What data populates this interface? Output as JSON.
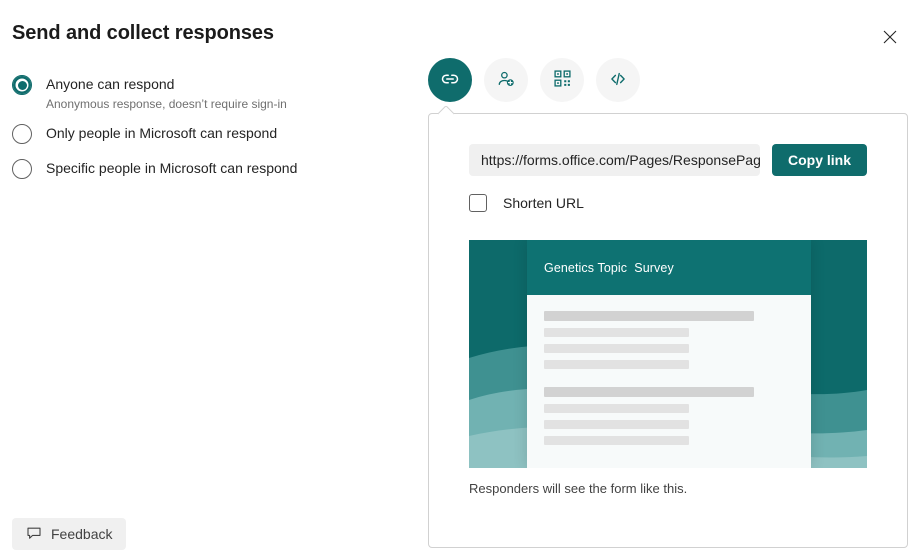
{
  "dialog": {
    "title": "Send and collect responses",
    "close_icon": "close-icon"
  },
  "audience_options": [
    {
      "label": "Anyone can respond",
      "sublabel": "Anonymous response, doesn’t require sign-in",
      "selected": true
    },
    {
      "label": "Only people in Microsoft can respond",
      "sublabel": "",
      "selected": false
    },
    {
      "label": "Specific people in Microsoft can respond",
      "sublabel": "",
      "selected": false
    }
  ],
  "share_tabs": [
    {
      "name": "link-tab",
      "icon": "link-icon",
      "active": true
    },
    {
      "name": "invite-people-tab",
      "icon": "person-add-icon",
      "active": false
    },
    {
      "name": "qr-code-tab",
      "icon": "qr-code-icon",
      "active": false
    },
    {
      "name": "embed-code-tab",
      "icon": "embed-code-icon",
      "active": false
    }
  ],
  "link_panel": {
    "url_value": "https://forms.office.com/Pages/ResponsePag…",
    "url_placeholder": "https://forms.office.com/Pages/ResponsePage.aspx",
    "copy_label": "Copy link",
    "shorten_label": "Shorten URL",
    "shorten_checked": false,
    "preview_title": "Genetics Topic  Survey",
    "preview_caption": "Responders will see the form like this."
  },
  "feedback": {
    "label": "Feedback",
    "icon": "speech-bubble-icon"
  },
  "colors": {
    "accent_teal": "#0f6c6c",
    "preview_header_teal": "#0e7272",
    "panel_border": "#d1d1d1",
    "field_bg": "#f0f0f0",
    "tab_bg": "#f5f5f5",
    "muted_text": "#707070"
  },
  "preview_skeleton": [
    {
      "widths": [
        84,
        58,
        58,
        58
      ]
    },
    {
      "widths": [
        84,
        58,
        58,
        58
      ]
    }
  ]
}
